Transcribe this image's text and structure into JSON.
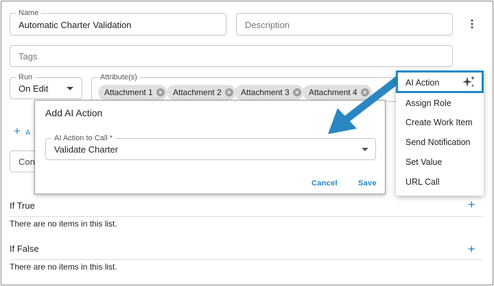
{
  "name_field": {
    "label": "Name",
    "value": "Automatic Charter Validation"
  },
  "description_field": {
    "placeholder": "Description"
  },
  "tags_field": {
    "placeholder": "Tags"
  },
  "run_field": {
    "label": "Run",
    "value": "On Edit"
  },
  "attributes_field": {
    "label": "Attribute(s)",
    "chips": [
      "Attachment 1",
      "Attachment 2",
      "Attachment 3",
      "Attachment 4"
    ]
  },
  "add_link": {
    "label": "A"
  },
  "condition_field": {
    "value": "Con"
  },
  "if_true": {
    "title": "If True",
    "empty_text": "There are no items in this list."
  },
  "if_false": {
    "title": "If False",
    "empty_text": "There are no items in this list."
  },
  "dialog": {
    "title": "Add AI Action",
    "select_label": "AI Action to Call *",
    "select_value": "Validate Charter",
    "cancel_label": "Cancel",
    "save_label": "Save"
  },
  "menu": {
    "items": [
      "AI Action",
      "Assign Role",
      "Create Work Item",
      "Send Notification",
      "Set Value",
      "URL Call"
    ]
  },
  "colors": {
    "accent": "#1e88c7",
    "chip_bg": "#e0e0e0",
    "border": "#c4c4c4"
  },
  "icons": [
    "more-vert-icon",
    "dropdown-arrow-icon",
    "chip-remove-icon",
    "plus-icon",
    "sparkle-icon",
    "callout-arrow"
  ]
}
